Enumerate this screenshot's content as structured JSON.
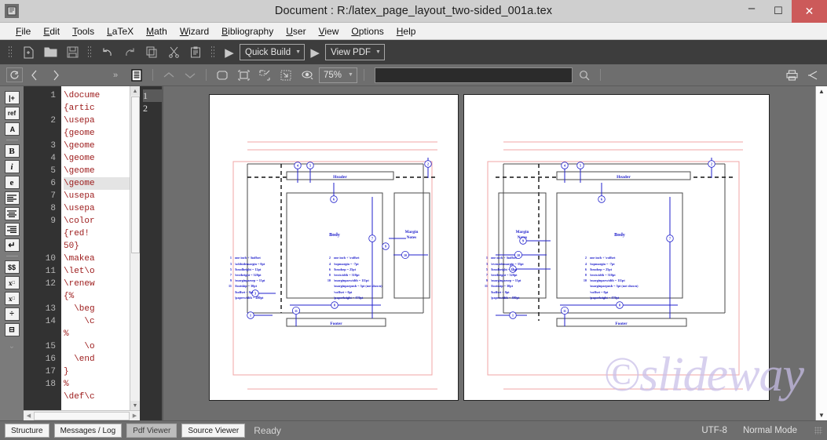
{
  "window": {
    "title": "Document : R:/latex_page_layout_two-sided_001a.tex",
    "app_icon": "texstudio-icon",
    "minimize": "–",
    "maximize": "☐",
    "close": "✕"
  },
  "menubar": {
    "items": [
      {
        "label": "File",
        "mnemonic": "F"
      },
      {
        "label": "Edit",
        "mnemonic": "E"
      },
      {
        "label": "Tools",
        "mnemonic": "T"
      },
      {
        "label": "LaTeX",
        "mnemonic": "L"
      },
      {
        "label": "Math",
        "mnemonic": "M"
      },
      {
        "label": "Wizard",
        "mnemonic": "W"
      },
      {
        "label": "Bibliography",
        "mnemonic": "B"
      },
      {
        "label": "User",
        "mnemonic": "U"
      },
      {
        "label": "View",
        "mnemonic": "V"
      },
      {
        "label": "Options",
        "mnemonic": "O"
      },
      {
        "label": "Help",
        "mnemonic": "H"
      }
    ]
  },
  "toolbar": {
    "icons": [
      "new-file-icon",
      "open-folder-icon",
      "save-icon",
      "undo-icon",
      "redo-icon",
      "copy-icon",
      "cut-icon",
      "paste-icon"
    ],
    "build_run_icon": "run-arrow-icon",
    "quick_build_label": "Quick Build",
    "view_run_icon": "run-arrow-icon",
    "view_pdf_label": "View PDF"
  },
  "pdf_toolbar": {
    "reload_icon": "reload-icon",
    "prev_icon": "chevron-left-icon",
    "next_icon": "chevron-right-icon",
    "more_icon": "double-chevron-icon",
    "layout_icon": "page-layout-icon",
    "up_icon": "chevron-up-icon",
    "down_icon": "chevron-down-icon",
    "fit_page_icon": "fit-page-icon",
    "fit_window_icon": "fit-window-icon",
    "zoom_in_icon": "zoom-in-icon",
    "zoom_out_icon": "zoom-out-icon",
    "magnify_icon": "magnifier-eye-icon",
    "zoom_value": "75%",
    "search_icon": "search-icon",
    "search_value": "",
    "print_icon": "print-icon",
    "close_icon": "collapse-icon"
  },
  "rail": {
    "items": [
      {
        "label": "|+",
        "name": "insert-icon"
      },
      {
        "label": "ref",
        "name": "reference-icon"
      },
      {
        "label": "A",
        "name": "font-size-icon"
      },
      {
        "label": "B",
        "name": "bold-icon"
      },
      {
        "label": "i",
        "name": "italic-icon"
      },
      {
        "label": "e",
        "name": "emphasis-icon"
      },
      {
        "label": "≡",
        "name": "align-left-icon"
      },
      {
        "label": "≡",
        "name": "align-center-icon"
      },
      {
        "label": "≡",
        "name": "align-right-icon"
      },
      {
        "label": "↵",
        "name": "newline-icon"
      },
      {
        "label": "$$",
        "name": "math-mode-icon"
      },
      {
        "label": "xₓ",
        "name": "subscript-icon"
      },
      {
        "label": "xˣ",
        "name": "superscript-icon"
      },
      {
        "label": "÷",
        "name": "fraction-icon"
      },
      {
        "label": "⩟",
        "name": "binomial-icon"
      }
    ],
    "more": "⌄"
  },
  "editor": {
    "line_numbers": [
      "1",
      "",
      "2",
      "",
      "3",
      "4",
      "5",
      "6",
      "7",
      "8",
      "9",
      "",
      "",
      "10",
      "11",
      "12",
      "",
      "13",
      "14",
      "",
      "15",
      "16",
      "17",
      "18",
      ""
    ],
    "lines": [
      "\\docume",
      "{artic​",
      "\\usepa​",
      "{geome​",
      "\\geome​",
      "\\geome​",
      "\\geome​",
      "\\geome​",
      "\\usepa​",
      "\\usepa​",
      "\\color​",
      "{red!",
      "50}",
      "\\makea​",
      "\\let\\o​",
      "\\renew​",
      "{%",
      "  \\beg​",
      "    \\c​",
      "%",
      "    \\o​",
      "  \\end​",
      "}",
      "%",
      "\\def\\c"
    ],
    "highlight_index": 7
  },
  "structure_panel": {
    "items": [
      "1",
      "2"
    ],
    "selected_index": 0
  },
  "statusbar": {
    "buttons": [
      {
        "label": "Structure",
        "pressed": false
      },
      {
        "label": "Messages / Log",
        "pressed": false
      },
      {
        "label": "Pdf Viewer",
        "pressed": true
      },
      {
        "label": "Source Viewer",
        "pressed": false
      }
    ],
    "status": "Ready",
    "encoding": "UTF-8",
    "mode": "Normal Mode"
  },
  "watermark": "©slideway",
  "pdf_pages": [
    {
      "page_label": "odd-page",
      "body_label": "Body",
      "margin_label": "Margin\nNotes",
      "header_label": "Header",
      "footer_label": "Footer",
      "body_side": "left",
      "legend": [
        {
          "n": "1",
          "text": "one inch + \\hoffset",
          "n2": "2",
          "text2": "one inch + \\voffset"
        },
        {
          "n": "3",
          "text": "\\oddsidemargin = 0pt",
          "n2": "4",
          "text2": "\\topmargin = -7pt"
        },
        {
          "n": "5",
          "text": "\\headheight = 12pt",
          "n2": "6",
          "text2": "\\headsep = 25pt"
        },
        {
          "n": "7",
          "text": "\\textheight = 320pt",
          "n2": "8",
          "text2": "\\textwidth = 310pt"
        },
        {
          "n": "9",
          "text": "\\marginparsep = 11pt",
          "n2": "10",
          "text2": "\\marginparwidth = 111pt"
        },
        {
          "n": "11",
          "text": "\\footskip = 30pt",
          "n2": "",
          "text2": "\\marginparpush = 5pt (not shown)"
        },
        {
          "n": "",
          "text": "\\hoffset = 0pt",
          "n2": "",
          "text2": "\\voffset = 0pt"
        },
        {
          "n": "",
          "text": "\\paperwidth = 480pt",
          "n2": "",
          "text2": "\\paperheight = 470pt"
        }
      ]
    },
    {
      "page_label": "even-page",
      "body_label": "Body",
      "margin_label": "Margin\nNotes",
      "header_label": "Header",
      "footer_label": "Footer",
      "body_side": "right",
      "legend": [
        {
          "n": "1",
          "text": "one inch + \\hoffset",
          "n2": "2",
          "text2": "one inch + \\voffset"
        },
        {
          "n": "3",
          "text": "\\evensidemargin = 35pt",
          "n2": "4",
          "text2": "\\topmargin = -7pt"
        },
        {
          "n": "5",
          "text": "\\headheight = 12pt",
          "n2": "6",
          "text2": "\\headsep = 25pt"
        },
        {
          "n": "7",
          "text": "\\textheight = 320pt",
          "n2": "8",
          "text2": "\\textwidth = 310pt"
        },
        {
          "n": "9",
          "text": "\\marginparsep = 11pt",
          "n2": "10",
          "text2": "\\marginparwidth = 111pt"
        },
        {
          "n": "11",
          "text": "\\footskip = 30pt",
          "n2": "",
          "text2": "\\marginparpush = 5pt (not shown)"
        },
        {
          "n": "",
          "text": "\\hoffset = 0pt",
          "n2": "",
          "text2": "\\voffset = 0pt"
        },
        {
          "n": "",
          "text": "\\paperwidth = 480pt",
          "n2": "",
          "text2": "\\paperheight = 470pt"
        }
      ]
    }
  ],
  "colors": {
    "accent_blue": "#2222cc",
    "page_border_red": "#f0a5a5",
    "close_red": "#cc5a5a",
    "toolbar_dark": "#3d3d3d",
    "chrome_gray": "#6e6e6e"
  }
}
